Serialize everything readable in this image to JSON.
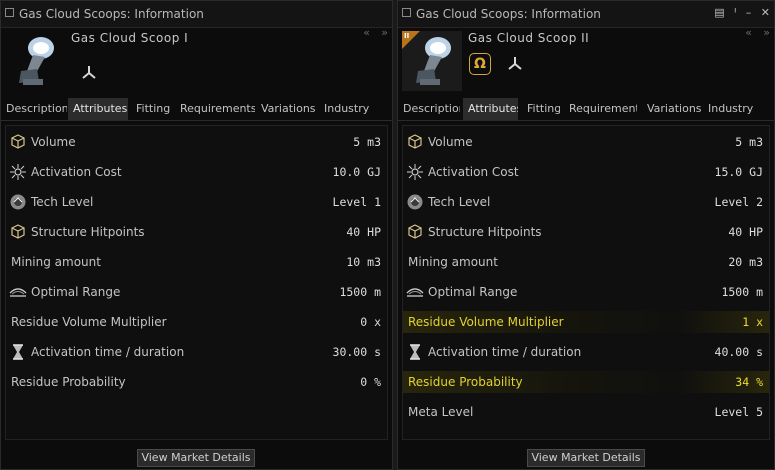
{
  "left": {
    "title": "Gas Cloud Scoops: Information",
    "item_name": "Gas Cloud Scoop I",
    "tabs": [
      "Description",
      "Attributes",
      "Fitting",
      "Requirements",
      "Variations",
      "Industry"
    ],
    "active_tab": "Attributes",
    "attributes": [
      {
        "label": "Volume",
        "value": "5 m3",
        "icon": "cube-icon"
      },
      {
        "label": "Activation Cost",
        "value": "10.0 GJ",
        "icon": "capacitor-icon"
      },
      {
        "label": "Tech Level",
        "value": "Level 1",
        "icon": "tech-level-icon"
      },
      {
        "label": "Structure Hitpoints",
        "value": "40 HP",
        "icon": "cube-icon"
      },
      {
        "label": "Mining amount",
        "value": "10 m3",
        "icon": ""
      },
      {
        "label": "Optimal Range",
        "value": "1500 m",
        "icon": "range-icon"
      },
      {
        "label": "Residue Volume Multiplier",
        "value": "0 x",
        "icon": ""
      },
      {
        "label": "Activation time / duration",
        "value": "30.00 s",
        "icon": "hourglass-icon"
      },
      {
        "label": "Residue Probability",
        "value": "0 %",
        "icon": ""
      }
    ],
    "market_button": "View Market Details"
  },
  "right": {
    "title": "Gas Cloud Scoops: Information",
    "item_name": "Gas Cloud Scoop II",
    "tech_badge": "II",
    "omega_symbol": "Ω",
    "tabs": [
      "Description",
      "Attributes",
      "Fitting",
      "Requirements",
      "Variations",
      "Industry"
    ],
    "active_tab": "Attributes",
    "attributes": [
      {
        "label": "Volume",
        "value": "5 m3",
        "icon": "cube-icon"
      },
      {
        "label": "Activation Cost",
        "value": "15.0 GJ",
        "icon": "capacitor-icon"
      },
      {
        "label": "Tech Level",
        "value": "Level 2",
        "icon": "tech-level-icon"
      },
      {
        "label": "Structure Hitpoints",
        "value": "40 HP",
        "icon": "cube-icon"
      },
      {
        "label": "Mining amount",
        "value": "20 m3",
        "icon": ""
      },
      {
        "label": "Optimal Range",
        "value": "1500 m",
        "icon": "range-icon"
      },
      {
        "label": "Residue Volume Multiplier",
        "value": "1 x",
        "icon": "",
        "highlight": true
      },
      {
        "label": "Activation time / duration",
        "value": "40.00 s",
        "icon": "hourglass-icon"
      },
      {
        "label": "Residue Probability",
        "value": "34 %",
        "icon": "",
        "highlight": true
      },
      {
        "label": "Meta Level",
        "value": "Level 5",
        "icon": ""
      }
    ],
    "market_button": "View Market Details"
  },
  "colors": {
    "highlight_text": "#f0dc2e",
    "omega_gold": "#e0a838",
    "tech_badge": "#b8731d"
  }
}
